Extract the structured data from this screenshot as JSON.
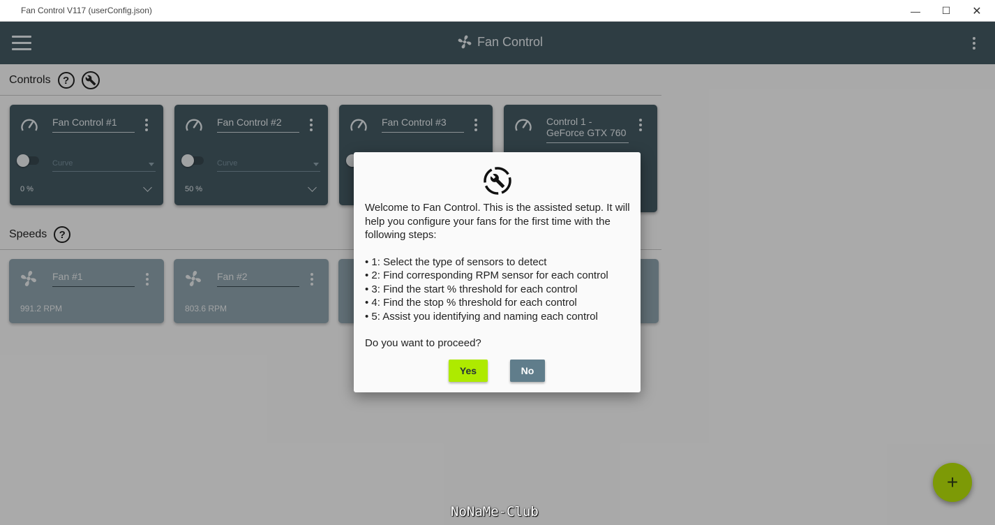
{
  "window": {
    "title": "Fan Control V117 (userConfig.json)",
    "minimize": "—",
    "maximize": "☐",
    "close": "✕"
  },
  "appbar": {
    "title": "Fan Control",
    "icons": [
      "hamburger-icon",
      "fan-icon",
      "more-vert-icon"
    ]
  },
  "controls_section": {
    "title": "Controls",
    "help": "?",
    "cards": [
      {
        "name": "Fan Control #1",
        "curve": "Curve",
        "percent": "0 %"
      },
      {
        "name": "Fan Control #2",
        "curve": "Curve",
        "percent": "50 %"
      },
      {
        "name": "Fan Control #3"
      },
      {
        "name_line1": "Control 1 -",
        "name_line2": "GeForce GTX 760"
      }
    ]
  },
  "speeds_section": {
    "title": "Speeds",
    "help": "?",
    "cards": [
      {
        "name": "Fan #1",
        "rpm": "991.2 RPM"
      },
      {
        "name": "Fan #2",
        "rpm": "803.6 RPM"
      }
    ]
  },
  "dialog": {
    "intro": "Welcome to Fan Control. This is the assisted setup. It will help you configure your fans for the first time with the following steps:",
    "steps": [
      "• 1: Select the type of sensors to detect",
      "• 2: Find corresponding RPM sensor for each control",
      "• 3: Find the start % threshold for each control",
      "• 4: Find the stop % threshold for each control",
      "• 5: Assist you identifying and naming each control"
    ],
    "question": "Do you want to proceed?",
    "yes": "Yes",
    "no": "No"
  },
  "fab": "+",
  "watermark": "NoNaMe-Club",
  "colors": {
    "primary": "#455a64",
    "accent": "#aeea00",
    "secondary_button": "#607d8b",
    "speed_card": "#90a4ae"
  }
}
